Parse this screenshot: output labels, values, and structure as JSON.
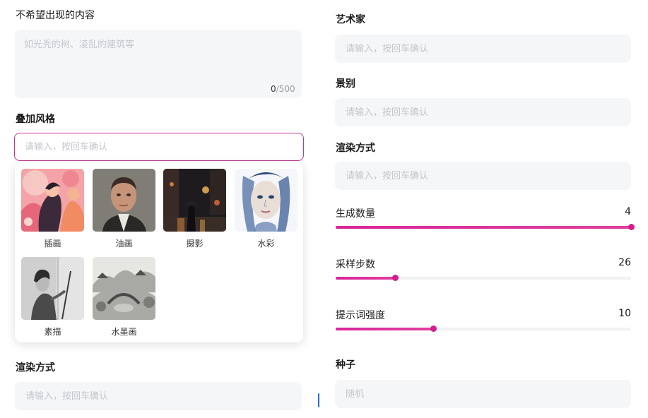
{
  "left": {
    "negative": {
      "label": "不希望出现的内容",
      "placeholder": "如光秃的树、凌乱的建筑等",
      "count": "0",
      "max": "/500"
    },
    "overlay_style": {
      "label": "叠加风格",
      "placeholder": "请输入，按回车确认",
      "options": [
        {
          "name": "插画",
          "icon": "illustration-thumbnail"
        },
        {
          "name": "油画",
          "icon": "oil-painting-thumbnail"
        },
        {
          "name": "摄影",
          "icon": "photography-thumbnail"
        },
        {
          "name": "水彩",
          "icon": "watercolor-thumbnail"
        },
        {
          "name": "素描",
          "icon": "sketch-thumbnail"
        },
        {
          "name": "水墨画",
          "icon": "ink-painting-thumbnail"
        }
      ]
    },
    "render_mode": {
      "label": "渲染方式",
      "placeholder": "请输入，按回车确认"
    }
  },
  "right": {
    "artist": {
      "label": "艺术家",
      "placeholder": "请输入，按回车确认"
    },
    "shot": {
      "label": "景别",
      "placeholder": "请输入，按回车确认"
    },
    "render_mode": {
      "label": "渲染方式",
      "placeholder": "请输入，按回车确认"
    },
    "sliders": {
      "count": {
        "label": "生成数量",
        "value": "4",
        "fraction": 1.0
      },
      "steps": {
        "label": "采样步数",
        "value": "26",
        "fraction": 0.2
      },
      "strength": {
        "label": "提示词强度",
        "value": "10",
        "fraction": 0.33
      }
    },
    "seed": {
      "label": "种子",
      "placeholder": "随机"
    }
  },
  "colors": {
    "accent": "#d21f8c",
    "field_bg": "#f5f6f8",
    "focus_border": "#c2378f"
  }
}
